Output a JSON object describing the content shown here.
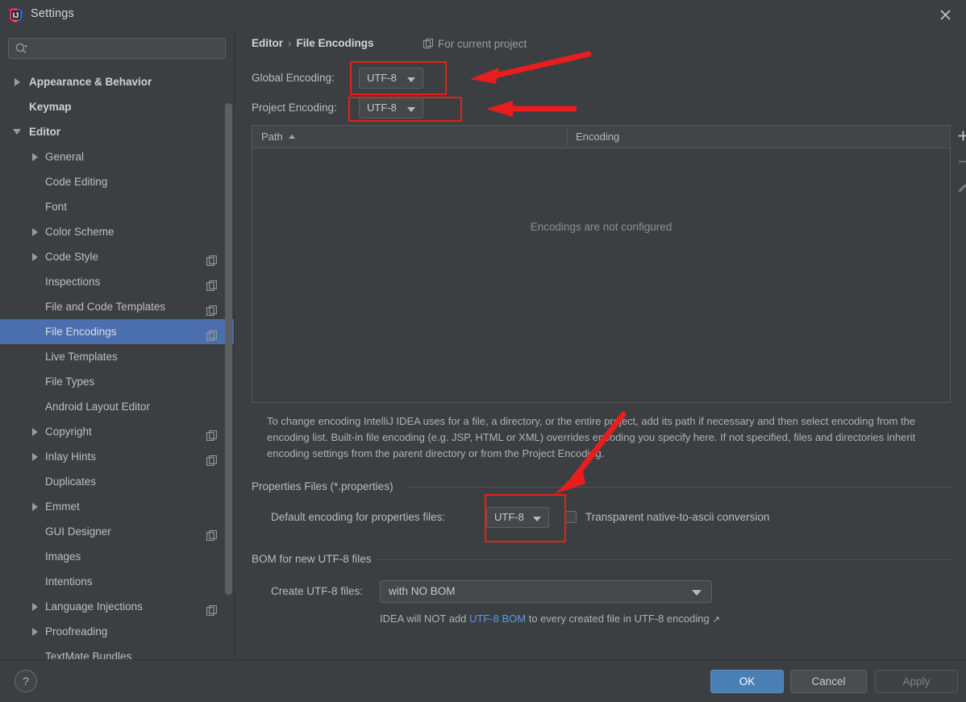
{
  "window": {
    "title": "Settings",
    "logo_icon": "intellij-idea-logo",
    "close_icon": "close-icon"
  },
  "sidebar": {
    "search": {
      "placeholder": "",
      "value": "",
      "icon": "search-icon"
    },
    "items": [
      {
        "label": "Appearance & Behavior",
        "level": 0,
        "arrow": "collapsed",
        "copy": false,
        "selected": false
      },
      {
        "label": "Keymap",
        "level": 0,
        "arrow": "none",
        "copy": false,
        "selected": false
      },
      {
        "label": "Editor",
        "level": 0,
        "arrow": "expanded",
        "copy": false,
        "selected": false
      },
      {
        "label": "General",
        "level": 1,
        "arrow": "collapsed",
        "copy": false,
        "selected": false
      },
      {
        "label": "Code Editing",
        "level": 1,
        "arrow": "none",
        "copy": false,
        "selected": false
      },
      {
        "label": "Font",
        "level": 1,
        "arrow": "none",
        "copy": false,
        "selected": false
      },
      {
        "label": "Color Scheme",
        "level": 1,
        "arrow": "collapsed",
        "copy": false,
        "selected": false
      },
      {
        "label": "Code Style",
        "level": 1,
        "arrow": "collapsed",
        "copy": true,
        "selected": false
      },
      {
        "label": "Inspections",
        "level": 1,
        "arrow": "none",
        "copy": true,
        "selected": false
      },
      {
        "label": "File and Code Templates",
        "level": 1,
        "arrow": "none",
        "copy": true,
        "selected": false
      },
      {
        "label": "File Encodings",
        "level": 1,
        "arrow": "none",
        "copy": true,
        "selected": true
      },
      {
        "label": "Live Templates",
        "level": 1,
        "arrow": "none",
        "copy": false,
        "selected": false
      },
      {
        "label": "File Types",
        "level": 1,
        "arrow": "none",
        "copy": false,
        "selected": false
      },
      {
        "label": "Android Layout Editor",
        "level": 1,
        "arrow": "none",
        "copy": false,
        "selected": false
      },
      {
        "label": "Copyright",
        "level": 1,
        "arrow": "collapsed",
        "copy": true,
        "selected": false
      },
      {
        "label": "Inlay Hints",
        "level": 1,
        "arrow": "collapsed",
        "copy": true,
        "selected": false
      },
      {
        "label": "Duplicates",
        "level": 1,
        "arrow": "none",
        "copy": false,
        "selected": false
      },
      {
        "label": "Emmet",
        "level": 1,
        "arrow": "collapsed",
        "copy": false,
        "selected": false
      },
      {
        "label": "GUI Designer",
        "level": 1,
        "arrow": "none",
        "copy": true,
        "selected": false
      },
      {
        "label": "Images",
        "level": 1,
        "arrow": "none",
        "copy": false,
        "selected": false
      },
      {
        "label": "Intentions",
        "level": 1,
        "arrow": "none",
        "copy": false,
        "selected": false
      },
      {
        "label": "Language Injections",
        "level": 1,
        "arrow": "collapsed",
        "copy": true,
        "selected": false
      },
      {
        "label": "Proofreading",
        "level": 1,
        "arrow": "collapsed",
        "copy": false,
        "selected": false
      },
      {
        "label": "TextMate Bundles",
        "level": 1,
        "arrow": "none",
        "copy": false,
        "selected": false
      }
    ]
  },
  "main": {
    "breadcrumb": {
      "parent": "Editor",
      "separator": "›",
      "current": "File Encodings"
    },
    "scope_badge": {
      "icon": "copy-icon",
      "label": "For current project"
    },
    "global_encoding": {
      "label": "Global Encoding:",
      "value": "UTF-8"
    },
    "project_encoding": {
      "label": "Project Encoding:",
      "value": "UTF-8"
    },
    "table": {
      "columns": [
        "Path",
        "Encoding"
      ],
      "sort_column": "Path",
      "sort_direction": "asc",
      "rows": [],
      "empty_message": "Encodings are not configured",
      "toolbar": [
        {
          "name": "add-row-button",
          "icon": "plus-icon"
        },
        {
          "name": "remove-row-button",
          "icon": "minus-icon"
        },
        {
          "name": "edit-row-button",
          "icon": "pencil-icon"
        }
      ]
    },
    "description": "To change encoding IntelliJ IDEA uses for a file, a directory, or the entire project, add its path if necessary and then select encoding from the encoding list. Built-in file encoding (e.g. JSP, HTML or XML) overrides encoding you specify here. If not specified, files and directories inherit encoding settings from the parent directory or from the Project Encoding.",
    "properties_group": {
      "title": "Properties Files (*.properties)",
      "default_encoding_label": "Default encoding for properties files:",
      "default_encoding_value": "UTF-8",
      "transparent_checkbox_label": "Transparent native-to-ascii conversion",
      "transparent_checkbox_checked": false
    },
    "bom_group": {
      "title": "BOM for new UTF-8 files",
      "create_label": "Create UTF-8 files:",
      "create_value": "with NO BOM",
      "note_prefix": "IDEA will NOT add ",
      "note_link": "UTF-8 BOM",
      "note_suffix": " to every created file in UTF-8 encoding",
      "external_link_icon": "external-link-icon"
    }
  },
  "footer": {
    "help_label": "?",
    "ok_label": "OK",
    "cancel_label": "Cancel",
    "apply_label": "Apply"
  },
  "annotations": {
    "highlight_color": "#e81e1e",
    "boxes": [
      {
        "name": "global-encoding-highlight"
      },
      {
        "name": "project-encoding-highlight"
      },
      {
        "name": "properties-encoding-highlight"
      }
    ],
    "arrows": [
      {
        "name": "arrow-to-global-encoding"
      },
      {
        "name": "arrow-to-project-encoding"
      },
      {
        "name": "arrow-to-properties-encoding"
      }
    ]
  },
  "colors": {
    "background": "#3c3f41",
    "selection": "#4b6eaf",
    "accent_button": "#4a7fb5",
    "link": "#5a9ce0"
  }
}
